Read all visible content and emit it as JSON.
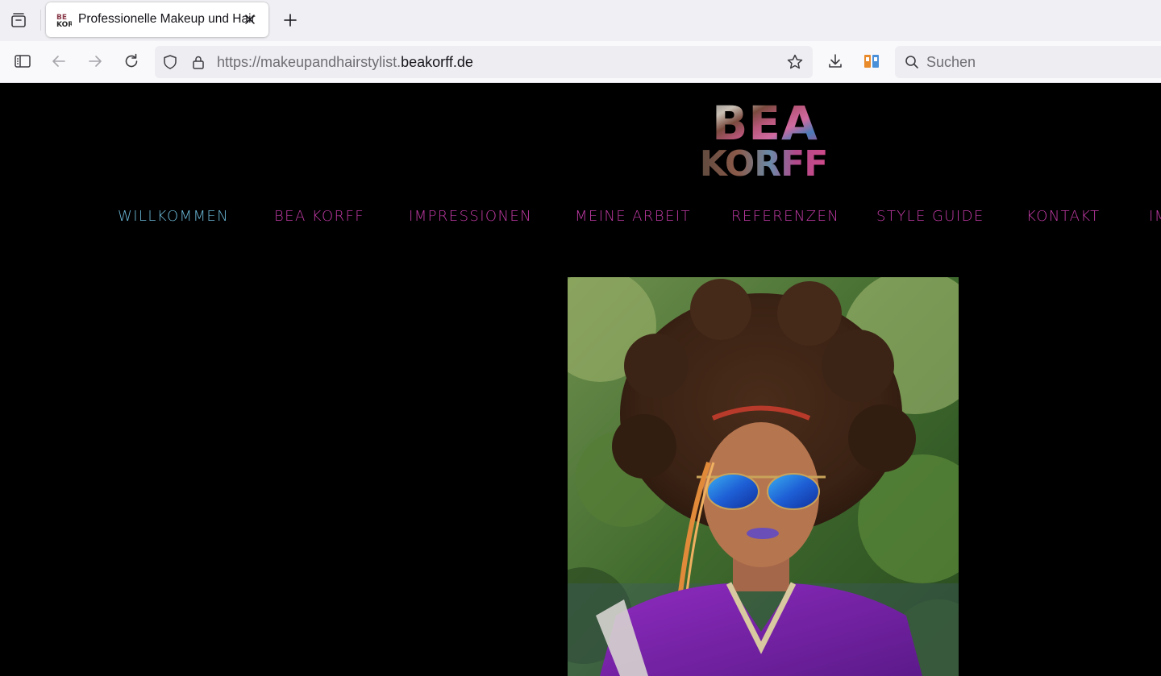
{
  "browser": {
    "tab": {
      "title": "Professionelle Makeup und Hairstylist Bea Korff"
    },
    "url": {
      "prefix": "https://makeupandhairstylist.",
      "domain": "beakorff.de"
    },
    "search": {
      "placeholder": "Suchen"
    },
    "icons": {
      "tab_list": "tab-list-icon",
      "close_tab": "close-icon",
      "new_tab": "plus-icon",
      "sidebar": "sidebar-icon",
      "back": "back-arrow-icon",
      "forward": "forward-arrow-icon",
      "reload": "reload-icon",
      "tracking_protection": "shield-icon",
      "secure": "lock-icon",
      "bookmark": "star-icon",
      "downloads": "download-icon",
      "extension": "extension-icon",
      "search": "search-icon"
    }
  },
  "site": {
    "logo": {
      "line1": "BEA",
      "line2": "KORFF"
    },
    "nav": [
      {
        "label": "WILLKOMMEN",
        "active": true
      },
      {
        "label": "BEA KORFF",
        "active": false
      },
      {
        "label": "IMPRESSIONEN",
        "active": false
      },
      {
        "label": "MEINE ARBEIT",
        "active": false
      },
      {
        "label": "REFERENZEN",
        "active": false
      },
      {
        "label": "STYLE GUIDE",
        "active": false
      },
      {
        "label": "KONTAKT",
        "active": false
      },
      {
        "label": "IMPRESSUM",
        "active": false
      }
    ],
    "colors": {
      "background": "#000000",
      "nav_active": "#6bb8d6",
      "nav_default": "#c23ba6"
    }
  }
}
